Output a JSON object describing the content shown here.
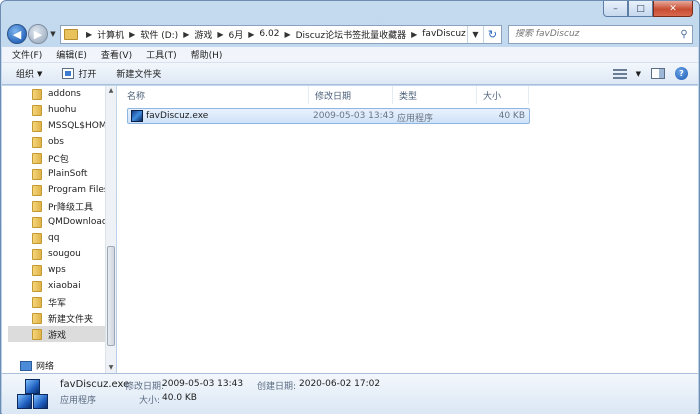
{
  "window": {
    "caption": {
      "minimize": "–",
      "maximize": "□",
      "close": "✕"
    }
  },
  "nav": {
    "back_glyph": "◀",
    "forward_glyph": "▶",
    "breadcrumbs": [
      "计算机",
      "软件 (D:)",
      "游戏",
      "6月",
      "6.02",
      "Discuz论坛书签批量收藏器",
      "favDiscuz"
    ],
    "search_placeholder": "搜索 favDiscuz"
  },
  "menu": [
    "文件(F)",
    "编辑(E)",
    "查看(V)",
    "工具(T)",
    "帮助(H)"
  ],
  "toolbar": {
    "organize": "组织",
    "open": "打开",
    "new_folder": "新建文件夹"
  },
  "tree": {
    "items": [
      "addons",
      "huohu",
      "MSSQL$HOM",
      "obs",
      "PC包",
      "PlainSoft",
      "Program Files",
      "Pr降级工具",
      "QMDownload",
      "qq",
      "sougou",
      "wps",
      "xiaobai",
      "华军",
      "新建文件夹",
      "游戏"
    ],
    "selected": "游戏",
    "network": "网络"
  },
  "columns": {
    "name": "名称",
    "modified": "修改日期",
    "type": "类型",
    "size": "大小"
  },
  "files": [
    {
      "name": "favDiscuz.exe",
      "modified": "2009-05-03 13:43",
      "type": "应用程序",
      "size": "40 KB"
    }
  ],
  "details": {
    "filename": "favDiscuz.exe",
    "modified_label": "修改日期:",
    "modified_value": "2009-05-03 13:43",
    "created_label": "创建日期:",
    "created_value": "2020-06-02 17:02",
    "type": "应用程序",
    "size_label": "大小:",
    "size_value": "40.0 KB"
  },
  "colors": {
    "selection": "#cfe2f8",
    "frame": "#b4cde6",
    "accent": "#2d6ac0"
  },
  "icons": [
    "back-arrow",
    "forward-arrow",
    "folder",
    "refresh",
    "search",
    "view-options",
    "preview-pane",
    "help",
    "exe-application",
    "network"
  ]
}
